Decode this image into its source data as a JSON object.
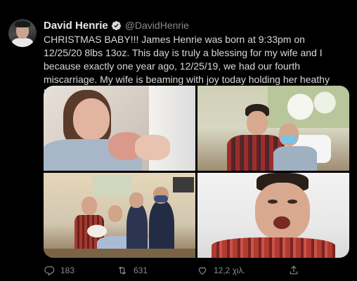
{
  "tweet": {
    "display_name": "David Henrie",
    "handle": "@DavidHenrie",
    "verified": true,
    "text": "CHRISTMAS BABY!!! James Henrie was born at 9:33pm on 12/25/20 8lbs 13oz. This day is truly a blessing for my wife and I because exactly one year ago, 12/25/19, we had our fourth miscarriage. My wife is beaming with joy today holding her heathy baby. Merry Christmas. Deo gratias!",
    "media_count": 4
  },
  "actions": {
    "reply_icon": "reply-icon",
    "reply_count": "183",
    "retweet_icon": "retweet-icon",
    "retweet_count": "631",
    "like_icon": "heart-icon",
    "like_count": "12,2 χιλ.",
    "share_icon": "share-icon"
  },
  "colors": {
    "background": "#000000",
    "text": "#d9d9d9",
    "muted": "#8a8a8a",
    "verified": "#d9d9d9"
  }
}
